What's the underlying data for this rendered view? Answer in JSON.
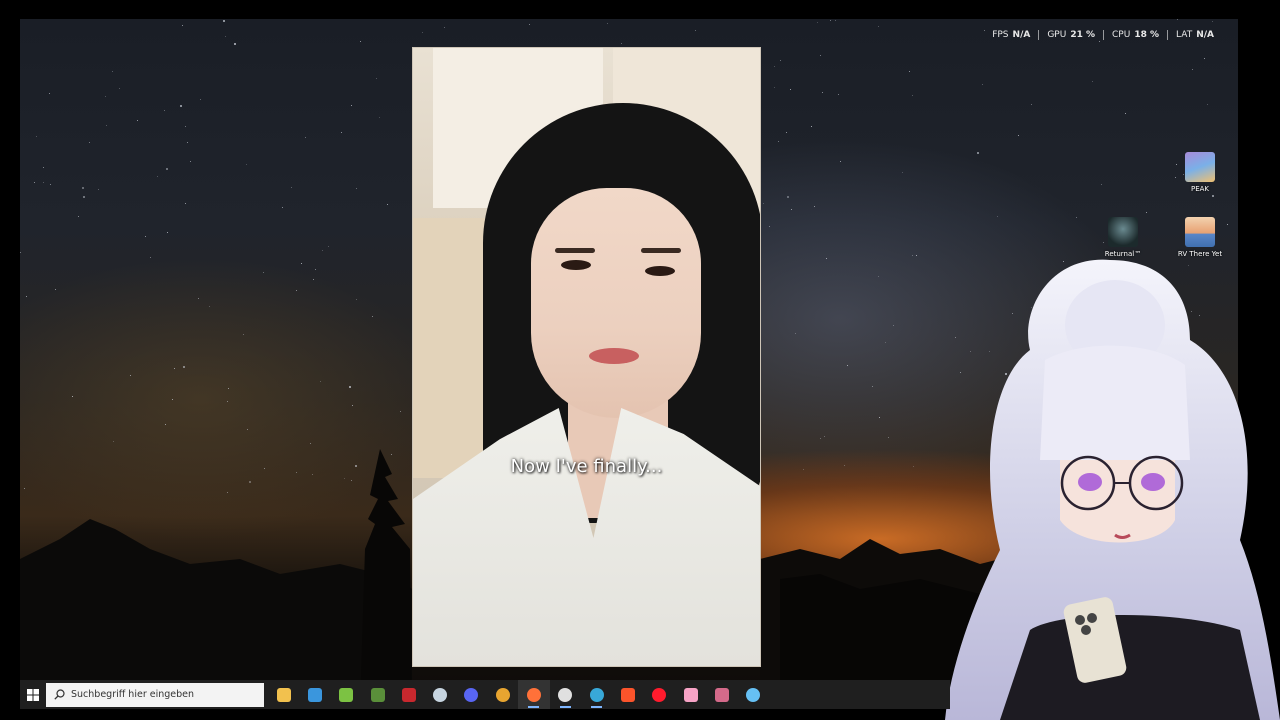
{
  "overlay_stats": [
    {
      "label": "FPS",
      "value": "N/A"
    },
    {
      "label": "GPU",
      "value": "21 %"
    },
    {
      "label": "CPU",
      "value": "18 %"
    },
    {
      "label": "LAT",
      "value": "N/A"
    }
  ],
  "video": {
    "subtitle": "Now I've finally..."
  },
  "desktop_icons": [
    {
      "label": "PEAK",
      "icon": "peak-game-icon"
    },
    {
      "label": "Returnal™",
      "icon": "returnal-game-icon"
    },
    {
      "label": "RV There Yet",
      "icon": "rv-there-yet-game-icon"
    }
  ],
  "taskbar": {
    "search_placeholder": "Suchbegriff hier eingeben",
    "apps": [
      {
        "name": "file-explorer",
        "icon": "folder-icon",
        "color": "#f2c14e"
      },
      {
        "name": "microsoft-store",
        "icon": "store-icon",
        "color": "#3a96dd"
      },
      {
        "name": "android-app",
        "icon": "android-icon",
        "color": "#7cc243"
      },
      {
        "name": "minecraft",
        "icon": "minecraft-icon",
        "color": "#5a8f3a"
      },
      {
        "name": "game-launcher",
        "icon": "launcher-icon",
        "color": "#c8282e"
      },
      {
        "name": "steam",
        "icon": "steam-icon",
        "color": "#c7d5e0"
      },
      {
        "name": "discord",
        "icon": "discord-icon",
        "color": "#5865f2"
      },
      {
        "name": "chrome",
        "icon": "chrome-icon",
        "color": "#e8a530"
      },
      {
        "name": "firefox",
        "icon": "firefox-icon",
        "color": "#ff7139"
      },
      {
        "name": "streamlabs",
        "icon": "streamlabs-icon",
        "color": "#e0e0e0"
      },
      {
        "name": "app-blue",
        "icon": "blue-app-icon",
        "color": "#38a8d8"
      },
      {
        "name": "brave",
        "icon": "brave-icon",
        "color": "#fb542b"
      },
      {
        "name": "opera",
        "icon": "opera-icon",
        "color": "#ff1b2d"
      },
      {
        "name": "pink-app",
        "icon": "pink-app-icon",
        "color": "#f7a3c6"
      },
      {
        "name": "app-misc",
        "icon": "misc-app-icon",
        "color": "#d46a8a"
      },
      {
        "name": "steam-2",
        "icon": "steam-icon",
        "color": "#66c0f4"
      }
    ]
  },
  "colors": {
    "taskbar_bg": "#1f1f1f",
    "overlay_text": "#e8e8e8",
    "horizon_glow": "#e47828"
  }
}
